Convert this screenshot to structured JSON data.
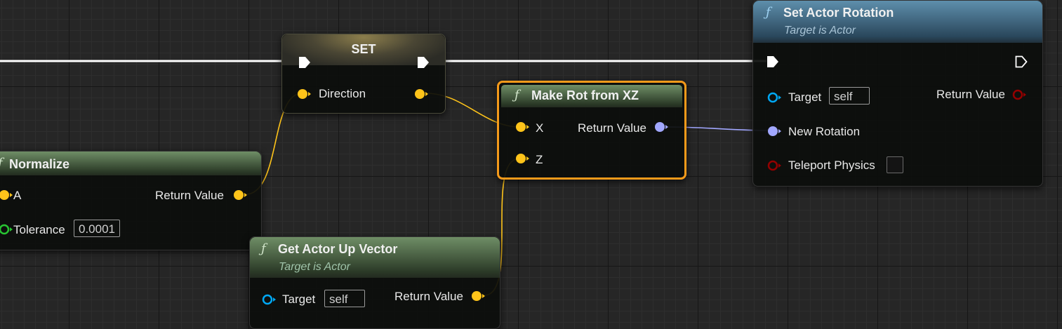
{
  "colors": {
    "float_pin": "#ffc41a",
    "rotator_pin": "#a1a7ff",
    "object_pin": "#00a8f4",
    "bool_pin": "#940000",
    "exec_wire": "#ffffff",
    "selected_outline": "#f59a1a"
  },
  "icons": {
    "function": "ƒ",
    "exec_pin": "exec-pin-icon",
    "data_pin": "data-pin-icon"
  },
  "set_node": {
    "title": "SET",
    "pin_label": "Direction"
  },
  "normalize_node": {
    "title": "Normalize",
    "input_a": "A",
    "output": "Return Value",
    "tolerance_label": "Tolerance",
    "tolerance_value": "0.0001"
  },
  "make_rot_node": {
    "title": "Make Rot from XZ",
    "input_x": "X",
    "input_z": "Z",
    "output": "Return Value"
  },
  "up_vector_node": {
    "title": "Get Actor Up Vector",
    "subtitle": "Target is Actor",
    "target_label": "Target",
    "target_value": "self",
    "output": "Return Value"
  },
  "set_rotation_node": {
    "title": "Set Actor Rotation",
    "subtitle": "Target is Actor",
    "target_label": "Target",
    "target_value": "self",
    "output": "Return Value",
    "new_rotation_label": "New Rotation",
    "teleport_label": "Teleport Physics",
    "teleport_checked": false
  }
}
